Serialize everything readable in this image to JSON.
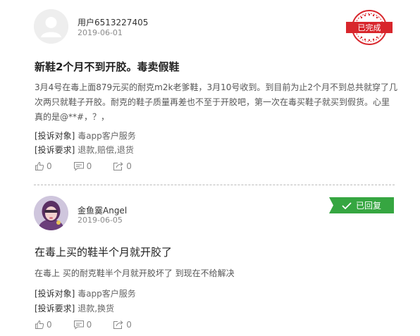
{
  "complaints": [
    {
      "user": "用户6513227405",
      "date": "2019-06-01",
      "status": "已完成",
      "title": "新鞋2个月不到开胶。毒卖假鞋",
      "content": "3月4号在毒上面879元买的耐克m2k老爹鞋，3月10号收到。到目前为止2个月不到总共就穿了几次两只就鞋子开胶。耐克的鞋子质量再差也不至于开胶吧，第一次在毒买鞋子就买到假货。心里真的是@**#，？，",
      "target_label": "[投诉对象]",
      "target": "毒app客户服务",
      "demand_label": "[投诉要求]",
      "demand": "退款,赔偿,退货",
      "likes": "0",
      "comments": "0",
      "shares": "0"
    },
    {
      "user": "金鱼霙Angel",
      "date": "2019-06-05",
      "status": "已回复",
      "title": "在毒上买的鞋半个月就开胶了",
      "content": "在毒上 买的耐克鞋半个月就开胶坏了 到现在不给解决",
      "target_label": "[投诉对象]",
      "target": "毒app客户服务",
      "demand_label": "[投诉要求]",
      "demand": "退款,换货",
      "likes": "0",
      "comments": "0",
      "shares": "0"
    }
  ],
  "colors": {
    "stamp_red": "#d8262c",
    "reply_green": "#36a641"
  },
  "icons": {
    "default_avatar": "user-silhouette-icon",
    "like": "thumbs-up-icon",
    "comment": "comment-icon",
    "share": "share-icon",
    "check": "check-icon"
  }
}
